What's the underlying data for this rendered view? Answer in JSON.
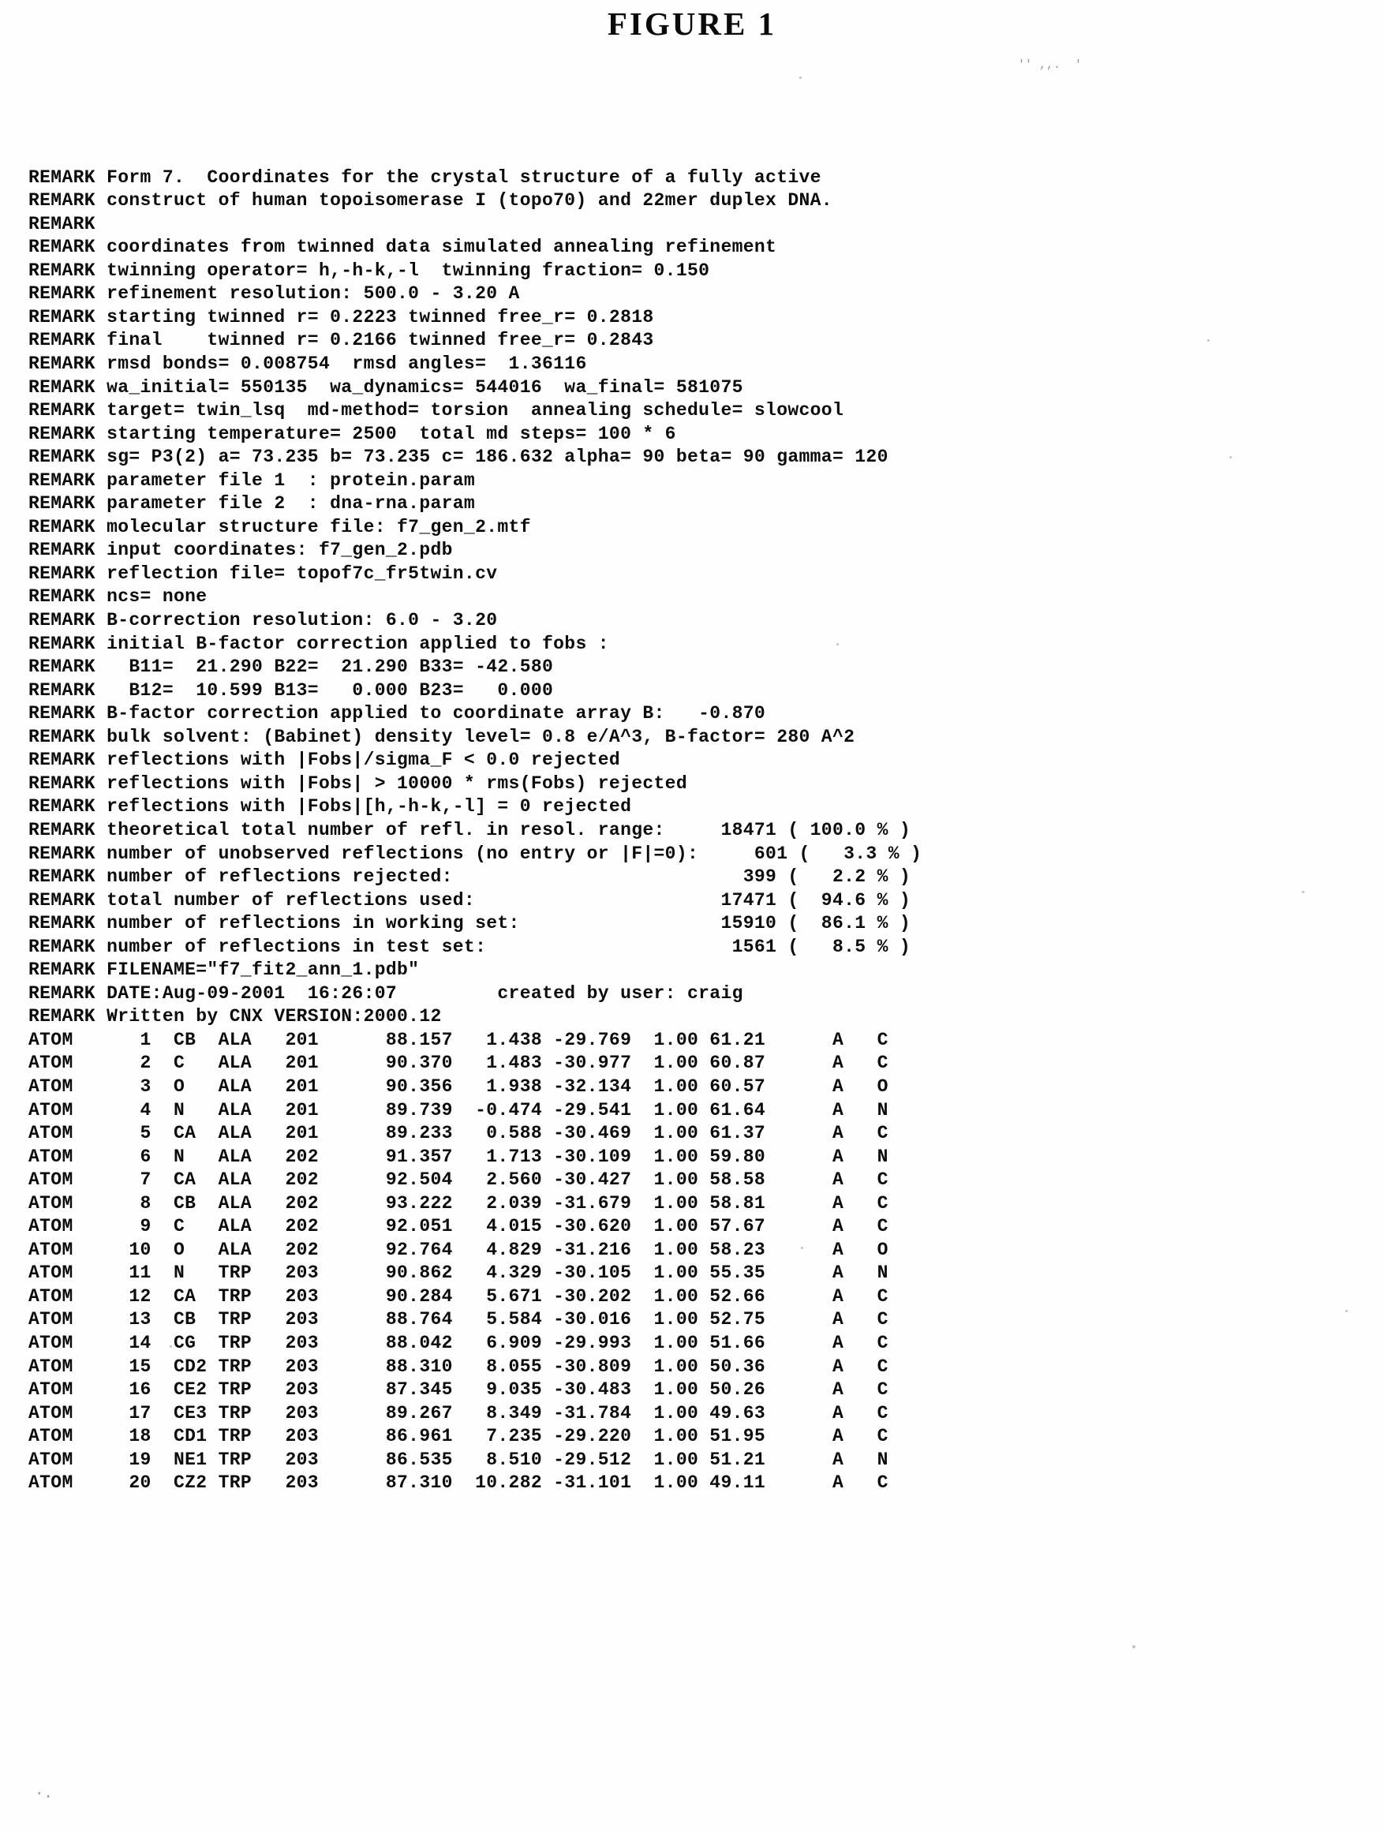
{
  "figure": {
    "title": "FIGURE 1"
  },
  "document": {
    "type": "pdb-coordinate-listing",
    "record_prefix_remark": "REMARK",
    "record_prefix_atom": "ATOM"
  },
  "remarks": [
    "REMARK Form 7.  Coordinates for the crystal structure of a fully active",
    "REMARK construct of human topoisomerase I (topo70) and 22mer duplex DNA.",
    "REMARK",
    "REMARK coordinates from twinned data simulated annealing refinement",
    "REMARK twinning operator= h,-h-k,-l  twinning fraction= 0.150",
    "REMARK refinement resolution: 500.0 - 3.20 A",
    "REMARK starting twinned r= 0.2223 twinned free_r= 0.2818",
    "REMARK final    twinned r= 0.2166 twinned free_r= 0.2843",
    "REMARK rmsd bonds= 0.008754  rmsd angles=  1.36116",
    "REMARK wa_initial= 550135  wa_dynamics= 544016  wa_final= 581075",
    "REMARK target= twin_lsq  md-method= torsion  annealing schedule= slowcool",
    "REMARK starting temperature= 2500  total md steps= 100 * 6",
    "REMARK sg= P3(2) a= 73.235 b= 73.235 c= 186.632 alpha= 90 beta= 90 gamma= 120",
    "REMARK parameter file 1  : protein.param",
    "REMARK parameter file 2  : dna-rna.param",
    "REMARK molecular structure file: f7_gen_2.mtf",
    "REMARK input coordinates: f7_gen_2.pdb",
    "REMARK reflection file= topof7c_fr5twin.cv",
    "REMARK ncs= none",
    "REMARK B-correction resolution: 6.0 - 3.20",
    "REMARK initial B-factor correction applied to fobs :",
    "REMARK   B11=  21.290 B22=  21.290 B33= -42.580",
    "REMARK   B12=  10.599 B13=   0.000 B23=   0.000",
    "REMARK B-factor correction applied to coordinate array B:   -0.870",
    "REMARK bulk solvent: (Babinet) density level= 0.8 e/A^3, B-factor= 280 A^2",
    "REMARK reflections with |Fobs|/sigma_F < 0.0 rejected",
    "REMARK reflections with |Fobs| > 10000 * rms(Fobs) rejected",
    "REMARK reflections with |Fobs|[h,-h-k,-l] = 0 rejected",
    "REMARK theoretical total number of refl. in resol. range:     18471 ( 100.0 % )",
    "REMARK number of unobserved reflections (no entry or |F|=0):     601 (   3.3 % )",
    "REMARK number of reflections rejected:                          399 (   2.2 % )",
    "REMARK total number of reflections used:                      17471 (  94.6 % )",
    "REMARK number of reflections in working set:                  15910 (  86.1 % )",
    "REMARK number of reflections in test set:                      1561 (   8.5 % )",
    "REMARK FILENAME=\"f7_fit2_ann_1.pdb\"",
    "REMARK DATE:Aug-09-2001  16:26:07         created by user: craig",
    "REMARK Written by CNX VERSION:2000.12"
  ],
  "remark_details": {
    "form_number": "Form 7.",
    "description_line_1": "Coordinates for the crystal structure of a fully active",
    "description_line_2": "construct of human topoisomerase I (topo70) and 22mer duplex DNA.",
    "twinning_operator": "h,-h-k,-l",
    "twinning_fraction": "0.150",
    "refinement_resolution": "500.0 - 3.20 A",
    "starting_twinned_r": "0.2223",
    "starting_twinned_free_r": "0.2818",
    "final_twinned_r": "0.2166",
    "final_twinned_free_r": "0.2843",
    "rmsd_bonds": "0.008754",
    "rmsd_angles": "1.36116",
    "wa_initial": "550135",
    "wa_dynamics": "544016",
    "wa_final": "581075",
    "target": "twin_lsq",
    "md_method": "torsion",
    "annealing_schedule": "slowcool",
    "starting_temperature": "2500",
    "total_md_steps": "100 * 6",
    "space_group": "P3(2)",
    "cell_a": "73.235",
    "cell_b": "73.235",
    "cell_c": "186.632",
    "cell_alpha": "90",
    "cell_beta": "90",
    "cell_gamma": "120",
    "parameter_file_1": "protein.param",
    "parameter_file_2": "dna-rna.param",
    "molecular_structure_file": "f7_gen_2.mtf",
    "input_coordinates": "f7_gen_2.pdb",
    "reflection_file": "topof7c_fr5twin.cv",
    "ncs": "none",
    "b_correction_resolution": "6.0 - 3.20",
    "b11": "21.290",
    "b22": "21.290",
    "b33": "-42.580",
    "b12": "10.599",
    "b13": "0.000",
    "b23": "0.000",
    "b_factor_coordinate_array": "-0.870",
    "bulk_solvent_density_level": "0.8 e/A^3",
    "bulk_solvent_b_factor": "280 A^2",
    "filename": "f7_fit2_ann_1.pdb",
    "date": "Aug-09-2001",
    "time": "16:26:07",
    "created_by_user": "craig",
    "written_by": "CNX VERSION:2000.12"
  },
  "reflection_statistics": {
    "columns": [
      "label",
      "count",
      "percent"
    ],
    "rows": [
      {
        "label": "theoretical total number of refl. in resol. range:",
        "count": "18471",
        "percent": "100.0 %"
      },
      {
        "label": "number of unobserved reflections (no entry or |F|=0):",
        "count": "601",
        "percent": "3.3 %"
      },
      {
        "label": "number of reflections rejected:",
        "count": "399",
        "percent": "2.2 %"
      },
      {
        "label": "total number of reflections used:",
        "count": "17471",
        "percent": "94.6 %"
      },
      {
        "label": "number of reflections in working set:",
        "count": "15910",
        "percent": "86.1 %"
      },
      {
        "label": "number of reflections in test set:",
        "count": "1561",
        "percent": "8.5 %"
      }
    ]
  },
  "atom_records": {
    "columns": [
      "record",
      "serial",
      "atom_name",
      "residue",
      "residue_seq",
      "x",
      "y",
      "z",
      "occupancy",
      "b_factor",
      "chain",
      "element"
    ],
    "rows": [
      [
        "ATOM",
        "1",
        "CB",
        "ALA",
        "201",
        "88.157",
        "1.438",
        "-29.769",
        "1.00",
        "61.21",
        "A",
        "C"
      ],
      [
        "ATOM",
        "2",
        "C",
        "ALA",
        "201",
        "90.370",
        "1.483",
        "-30.977",
        "1.00",
        "60.87",
        "A",
        "C"
      ],
      [
        "ATOM",
        "3",
        "O",
        "ALA",
        "201",
        "90.356",
        "1.938",
        "-32.134",
        "1.00",
        "60.57",
        "A",
        "O"
      ],
      [
        "ATOM",
        "4",
        "N",
        "ALA",
        "201",
        "89.739",
        "-0.474",
        "-29.541",
        "1.00",
        "61.64",
        "A",
        "N"
      ],
      [
        "ATOM",
        "5",
        "CA",
        "ALA",
        "201",
        "89.233",
        "0.588",
        "-30.469",
        "1.00",
        "61.37",
        "A",
        "C"
      ],
      [
        "ATOM",
        "6",
        "N",
        "ALA",
        "202",
        "91.357",
        "1.713",
        "-30.109",
        "1.00",
        "59.80",
        "A",
        "N"
      ],
      [
        "ATOM",
        "7",
        "CA",
        "ALA",
        "202",
        "92.504",
        "2.560",
        "-30.427",
        "1.00",
        "58.58",
        "A",
        "C"
      ],
      [
        "ATOM",
        "8",
        "CB",
        "ALA",
        "202",
        "93.222",
        "2.039",
        "-31.679",
        "1.00",
        "58.81",
        "A",
        "C"
      ],
      [
        "ATOM",
        "9",
        "C",
        "ALA",
        "202",
        "92.051",
        "4.015",
        "-30.620",
        "1.00",
        "57.67",
        "A",
        "C"
      ],
      [
        "ATOM",
        "10",
        "O",
        "ALA",
        "202",
        "92.764",
        "4.829",
        "-31.216",
        "1.00",
        "58.23",
        "A",
        "O"
      ],
      [
        "ATOM",
        "11",
        "N",
        "TRP",
        "203",
        "90.862",
        "4.329",
        "-30.105",
        "1.00",
        "55.35",
        "A",
        "N"
      ],
      [
        "ATOM",
        "12",
        "CA",
        "TRP",
        "203",
        "90.284",
        "5.671",
        "-30.202",
        "1.00",
        "52.66",
        "A",
        "C"
      ],
      [
        "ATOM",
        "13",
        "CB",
        "TRP",
        "203",
        "88.764",
        "5.584",
        "-30.016",
        "1.00",
        "52.75",
        "A",
        "C"
      ],
      [
        "ATOM",
        "14",
        "CG",
        "TRP",
        "203",
        "88.042",
        "6.909",
        "-29.993",
        "1.00",
        "51.66",
        "A",
        "C"
      ],
      [
        "ATOM",
        "15",
        "CD2",
        "TRP",
        "203",
        "88.310",
        "8.055",
        "-30.809",
        "1.00",
        "50.36",
        "A",
        "C"
      ],
      [
        "ATOM",
        "16",
        "CE2",
        "TRP",
        "203",
        "87.345",
        "9.035",
        "-30.483",
        "1.00",
        "50.26",
        "A",
        "C"
      ],
      [
        "ATOM",
        "17",
        "CE3",
        "TRP",
        "203",
        "89.267",
        "8.349",
        "-31.784",
        "1.00",
        "49.63",
        "A",
        "C"
      ],
      [
        "ATOM",
        "18",
        "CD1",
        "TRP",
        "203",
        "86.961",
        "7.235",
        "-29.220",
        "1.00",
        "51.95",
        "A",
        "C"
      ],
      [
        "ATOM",
        "19",
        "NE1",
        "TRP",
        "203",
        "86.535",
        "8.510",
        "-29.512",
        "1.00",
        "51.21",
        "A",
        "N"
      ],
      [
        "ATOM",
        "20",
        "CZ2",
        "TRP",
        "203",
        "87.310",
        "10.282",
        "-31.101",
        "1.00",
        "49.11",
        "A",
        "C"
      ]
    ],
    "formatted_lines": [
      "ATOM      1  CB  ALA   201      88.157   1.438 -29.769  1.00 61.21      A   C",
      "ATOM      2  C   ALA   201      90.370   1.483 -30.977  1.00 60.87      A   C",
      "ATOM      3  O   ALA   201      90.356   1.938 -32.134  1.00 60.57      A   O",
      "ATOM      4  N   ALA   201      89.739  -0.474 -29.541  1.00 61.64      A   N",
      "ATOM      5  CA  ALA   201      89.233   0.588 -30.469  1.00 61.37      A   C",
      "ATOM      6  N   ALA   202      91.357   1.713 -30.109  1.00 59.80      A   N",
      "ATOM      7  CA  ALA   202      92.504   2.560 -30.427  1.00 58.58      A   C",
      "ATOM      8  CB  ALA   202      93.222   2.039 -31.679  1.00 58.81      A   C",
      "ATOM      9  C   ALA   202      92.051   4.015 -30.620  1.00 57.67      A   C",
      "ATOM     10  O   ALA   202      92.764   4.829 -31.216  1.00 58.23      A   O",
      "ATOM     11  N   TRP   203      90.862   4.329 -30.105  1.00 55.35      A   N",
      "ATOM     12  CA  TRP   203      90.284   5.671 -30.202  1.00 52.66      A   C",
      "ATOM     13  CB  TRP   203      88.764   5.584 -30.016  1.00 52.75      A   C",
      "ATOM     14  CG  TRP   203      88.042   6.909 -29.993  1.00 51.66      A   C",
      "ATOM     15  CD2 TRP   203      88.310   8.055 -30.809  1.00 50.36      A   C",
      "ATOM     16  CE2 TRP   203      87.345   9.035 -30.483  1.00 50.26      A   C",
      "ATOM     17  CE3 TRP   203      89.267   8.349 -31.784  1.00 49.63      A   C",
      "ATOM     18  CD1 TRP   203      86.961   7.235 -29.220  1.00 51.95      A   C",
      "ATOM     19  NE1 TRP   203      86.535   8.510 -29.512  1.00 51.21      A   N",
      "ATOM     20  CZ2 TRP   203      87.310  10.282 -31.101  1.00 49.11      A   C"
    ]
  }
}
